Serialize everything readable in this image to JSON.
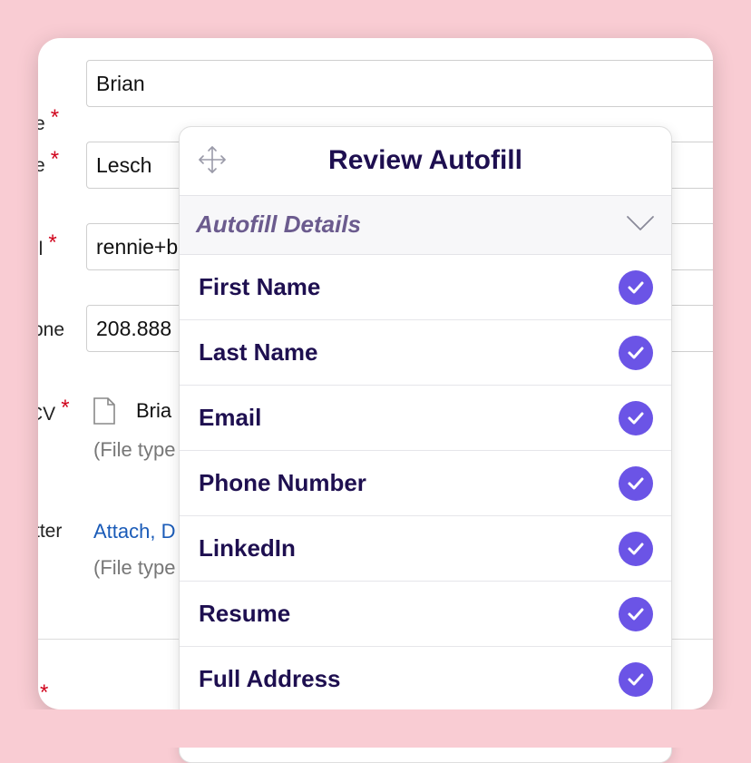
{
  "form": {
    "first_name_label": "e",
    "first_name_value": "Brian",
    "last_name_label": "e",
    "last_name_value": "Lesch",
    "email_label": "il",
    "email_value": "rennie+b",
    "phone_label": "one",
    "phone_value": "208.888",
    "cv_label": "CV",
    "cv_file": "Bria",
    "cv_hint": "(File type",
    "cover_label": "tter",
    "cover_link": "Attach, D",
    "cover_hint": "(File type",
    "required_mark": "*"
  },
  "panel": {
    "title": "Review Autofill",
    "section_title": "Autofill Details",
    "items": [
      {
        "label": "First Name",
        "checked": true
      },
      {
        "label": "Last Name",
        "checked": true
      },
      {
        "label": "Email",
        "checked": true
      },
      {
        "label": "Phone Number",
        "checked": true
      },
      {
        "label": "LinkedIn",
        "checked": true
      },
      {
        "label": "Resume",
        "checked": true
      },
      {
        "label": "Full Address",
        "checked": true
      }
    ]
  },
  "colors": {
    "background": "#f9ccd3",
    "accent": "#6b54e6",
    "title": "#1e0f50",
    "required": "#d0021b"
  }
}
